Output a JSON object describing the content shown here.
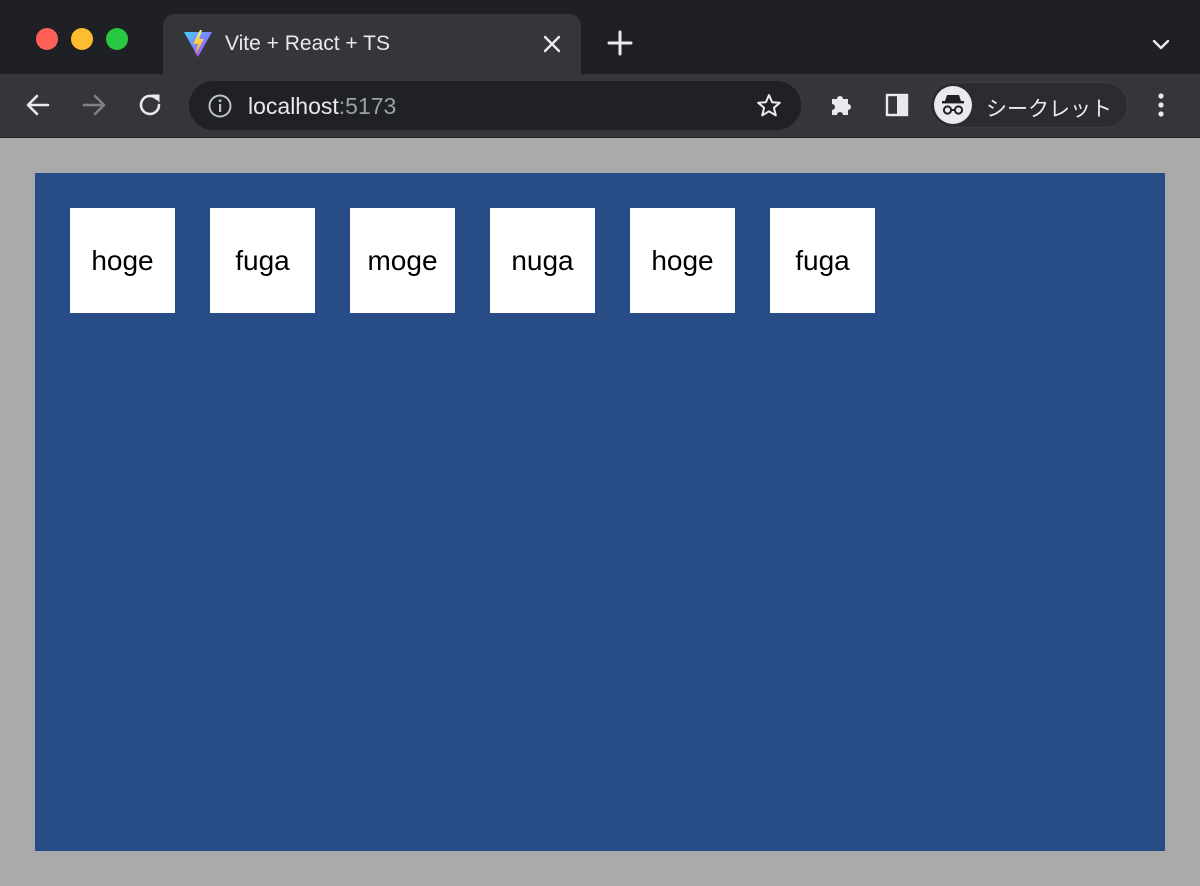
{
  "browser": {
    "tab": {
      "title": "Vite + React + TS",
      "favicon": "vite-logo-icon"
    },
    "url": {
      "host": "localhost",
      "port": ":5173"
    },
    "profile": {
      "label": "シークレット",
      "icon": "incognito-icon"
    },
    "colors": {
      "frame": "#1f2023",
      "toolbar": "#35363a",
      "omnibox": "#202124"
    }
  },
  "page": {
    "background": "#aaaaaa",
    "container_color": "#284c86",
    "items": [
      "hoge",
      "fuga",
      "moge",
      "nuga",
      "hoge",
      "fuga"
    ]
  }
}
